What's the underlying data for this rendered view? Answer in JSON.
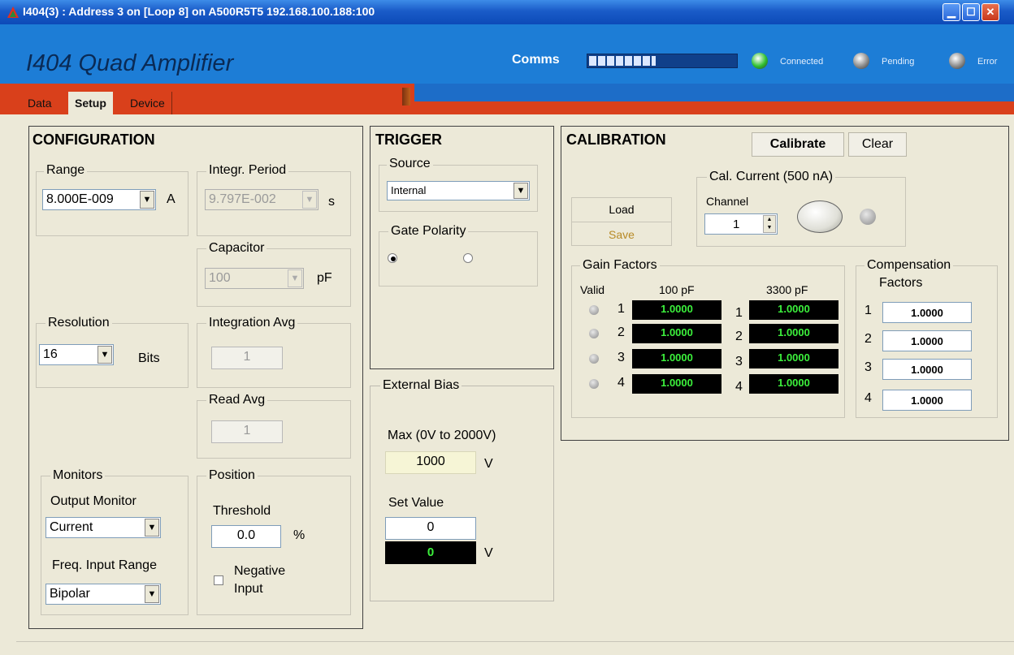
{
  "window": {
    "title": "I404(3) : Address 3 on [Loop 8] on A500R5T5 192.168.100.188:100"
  },
  "header": {
    "app_name": "I404 Quad Amplifier",
    "comms_label": "Comms",
    "comms_progress": 0.45,
    "status": [
      {
        "label": "Connected",
        "color": "#2ec02e"
      },
      {
        "label": "Pending",
        "color": "#8c8c8c"
      },
      {
        "label": "Error",
        "color": "#8c8c8c"
      }
    ]
  },
  "tabs": [
    {
      "label": "Data"
    },
    {
      "label": "Setup",
      "active": true
    },
    {
      "label": "Device"
    }
  ],
  "configuration": {
    "title": "CONFIGURATION",
    "range": {
      "label": "Range",
      "value": "8.000E-009",
      "unit": "A"
    },
    "integr_period": {
      "label": "Integr. Period",
      "value": "9.797E-002",
      "unit": "s"
    },
    "capacitor": {
      "label": "Capacitor",
      "value": "100",
      "unit": "pF"
    },
    "resolution": {
      "label": "Resolution",
      "value": "16",
      "unit": "Bits"
    },
    "integration_avg": {
      "label": "Integration Avg",
      "value": "1"
    },
    "read_avg": {
      "label": "Read Avg",
      "value": "1"
    },
    "monitors": {
      "label": "Monitors",
      "output_monitor_label": "Output Monitor",
      "output_monitor_value": "Current",
      "freq_input_range_label": "Freq. Input Range",
      "freq_input_range_value": "Bipolar"
    },
    "position": {
      "label": "Position",
      "threshold_label": "Threshold",
      "threshold_value": "0.0",
      "threshold_unit": "%",
      "negative_input_line1": "Negative",
      "negative_input_line2": "Input"
    }
  },
  "trigger": {
    "title": "TRIGGER",
    "source_label": "Source",
    "source_value": "Internal",
    "gate_polarity_label": "Gate Polarity"
  },
  "external_bias": {
    "label": "External Bias",
    "max_label": "Max (0V to 2000V)",
    "max_value": "1000",
    "max_unit": "V",
    "set_value_label": "Set Value",
    "set_value": "0",
    "readback": "0",
    "readback_unit": "V"
  },
  "calibration": {
    "title": "CALIBRATION",
    "calibrate_label": "Calibrate",
    "clear_label": "Clear",
    "load_label": "Load",
    "save_label": "Save",
    "cal_current_label": "Cal. Current (500 nA)",
    "channel_label": "Channel",
    "channel_value": "1",
    "gain_factors": {
      "label": "Gain Factors",
      "valid_header": "Valid",
      "col1_header": "100 pF",
      "col2_header": "3300 pF",
      "rows": [
        {
          "ch": "1",
          "v100": "1.0000",
          "v3300": "1.0000"
        },
        {
          "ch": "2",
          "v100": "1.0000",
          "v3300": "1.0000"
        },
        {
          "ch": "3",
          "v100": "1.0000",
          "v3300": "1.0000"
        },
        {
          "ch": "4",
          "v100": "1.0000",
          "v3300": "1.0000"
        }
      ]
    },
    "compensation_factors": {
      "label_line1": "Compensation",
      "label_line2": "Factors",
      "rows": [
        {
          "ch": "1",
          "value": "1.0000"
        },
        {
          "ch": "2",
          "value": "1.0000"
        },
        {
          "ch": "3",
          "value": "1.0000"
        },
        {
          "ch": "4",
          "value": "1.0000"
        }
      ]
    }
  }
}
